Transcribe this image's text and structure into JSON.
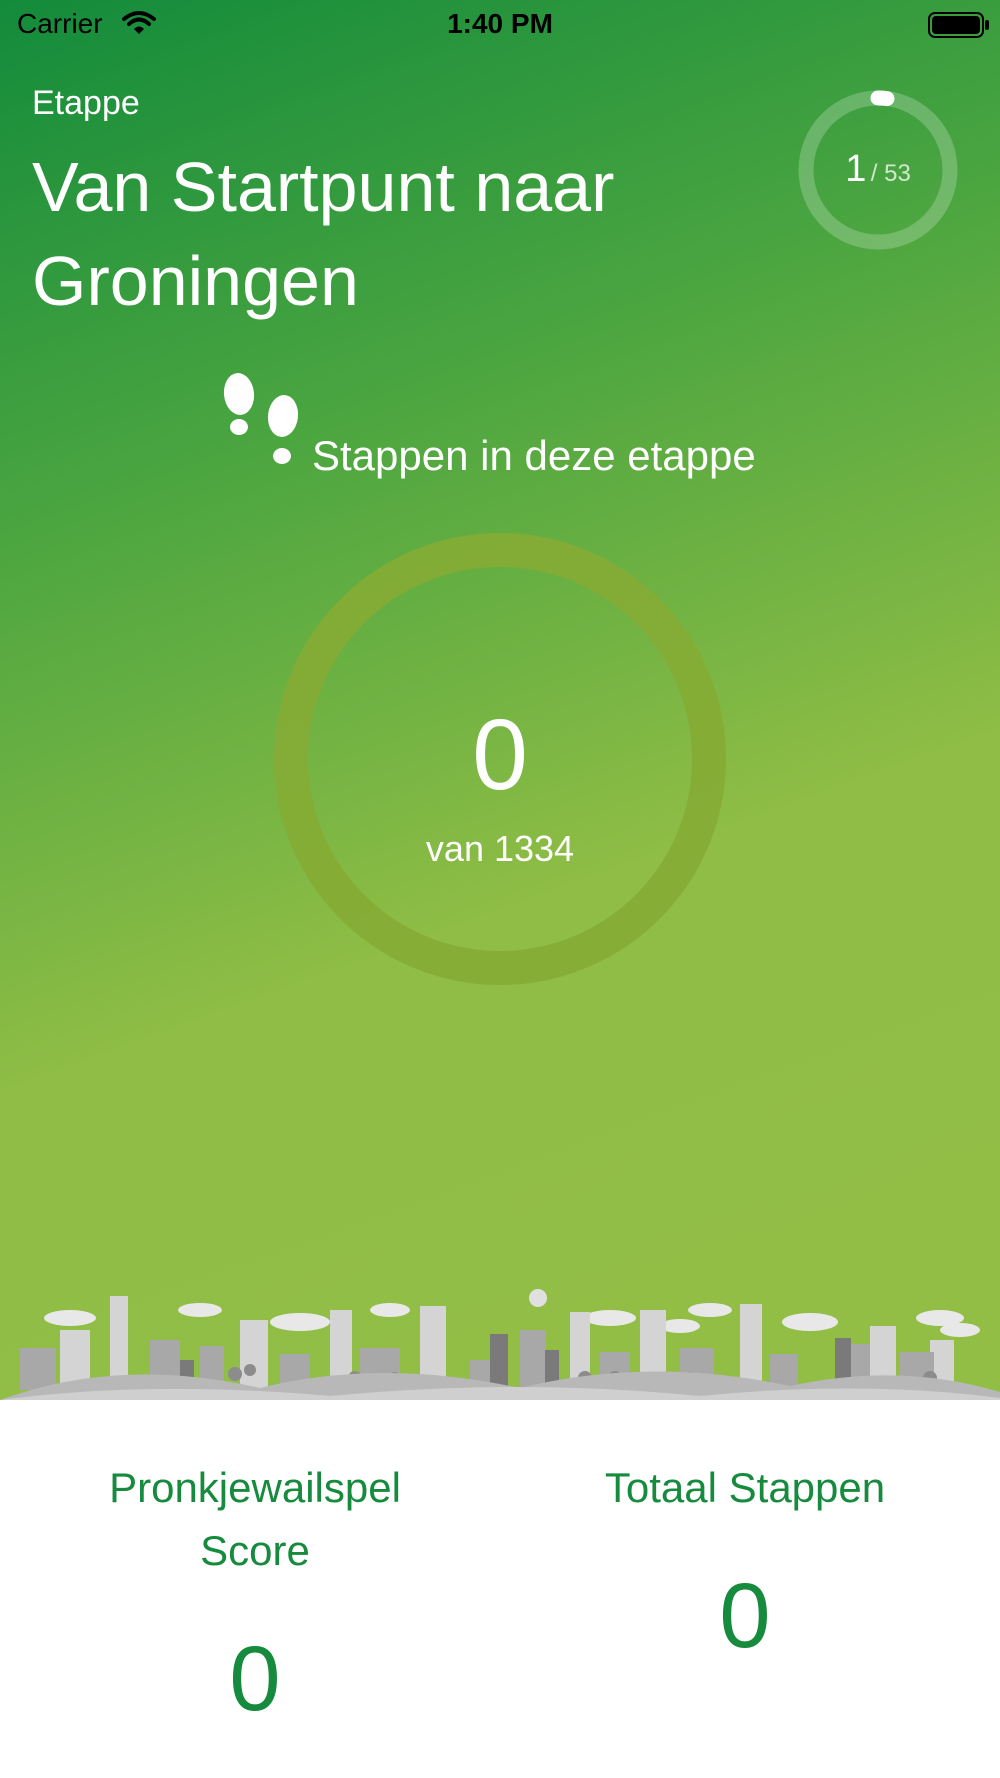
{
  "status_bar": {
    "carrier": "Carrier",
    "time": "1:40 PM"
  },
  "etappe": {
    "label": "Etappe",
    "title": "Van Startpunt naar Groningen",
    "current_stage": "1",
    "total_stages": "/ 53",
    "stage_progress": 0.02
  },
  "steps": {
    "heading": "Stappen in deze etappe",
    "count": "0",
    "of_text": "van 1334",
    "progress": 0
  },
  "stats": {
    "left": {
      "label": "Pronkjewailspel Score",
      "value": "0"
    },
    "right": {
      "label": "Totaal Stappen",
      "value": "0"
    }
  },
  "colors": {
    "gradient_top": "#138b3b",
    "gradient_bottom": "#93be46",
    "accent": "#168a3d",
    "ring_track": "#85ac35"
  },
  "icons": [
    "wifi-icon",
    "battery-icon",
    "footsteps-icon",
    "skyline-illustration"
  ]
}
